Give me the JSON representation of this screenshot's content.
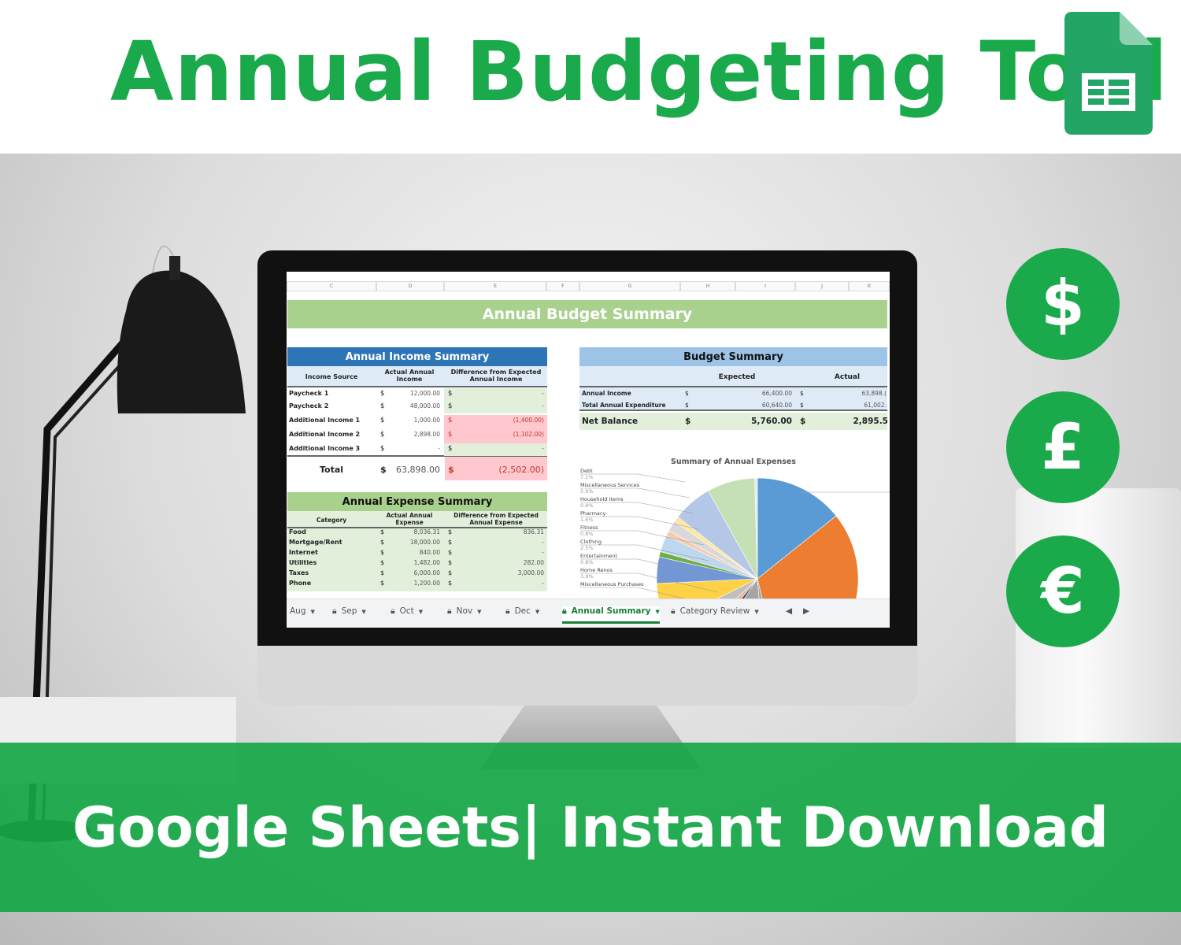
{
  "banner": {
    "title": "Annual Budgeting Tool",
    "footer": "Google Sheets| Instant Download",
    "accent": "#1aaa4b"
  },
  "icons": [
    "google-sheets-icon",
    "dollar-icon",
    "pound-icon",
    "euro-icon",
    "desk-lamp"
  ],
  "currency": [
    "$",
    "£",
    "€"
  ],
  "sheet": {
    "columns": [
      "C",
      "D",
      "E",
      "F",
      "G",
      "H",
      "I",
      "J",
      "K"
    ],
    "title": "Annual Budget Summary",
    "income": {
      "title": "Annual Income Summary",
      "headers": [
        "Income Source",
        "Actual Annual Income",
        "Difference from Expected Annual Income"
      ],
      "rows": [
        {
          "source": "Paycheck 1",
          "actual": "12,000.00",
          "diff": "-",
          "neg": false
        },
        {
          "source": "Paycheck 2",
          "actual": "48,000.00",
          "diff": "-",
          "neg": false
        },
        {
          "source": "Additional Income 1",
          "actual": "1,000.00",
          "diff": "(1,400.00)",
          "neg": true
        },
        {
          "source": "Additional Income 2",
          "actual": "2,898.00",
          "diff": "(1,102.00)",
          "neg": true
        },
        {
          "source": "Additional Income 3",
          "actual": "-",
          "diff": "-",
          "neg": false
        }
      ],
      "total_label": "Total",
      "total_actual": "63,898.00",
      "total_diff": "(2,502.00)",
      "currency": "$"
    },
    "expense": {
      "title": "Annual Expense Summary",
      "headers": [
        "Category",
        "Actual Annual Expense",
        "Difference from Expected Annual Expense"
      ],
      "rows": [
        {
          "category": "Food",
          "actual": "8,036.31",
          "diff": "836.31"
        },
        {
          "category": "Mortgage/Rent",
          "actual": "18,000.00",
          "diff": "-"
        },
        {
          "category": "Internet",
          "actual": "840.00",
          "diff": "-"
        },
        {
          "category": "Utilities",
          "actual": "1,482.00",
          "diff": "282.00"
        },
        {
          "category": "Taxes",
          "actual": "6,000.00",
          "diff": "3,000.00"
        },
        {
          "category": "Phone",
          "actual": "1,200.00",
          "diff": "-"
        }
      ]
    },
    "budget": {
      "title": "Budget Summary",
      "headers": [
        "Expected",
        "Actual"
      ],
      "rows": [
        {
          "label": "Annual Income",
          "expected": "66,400.00",
          "actual": "63,898.("
        },
        {
          "label": "Total Annual Expenditure",
          "expected": "60,640.00",
          "actual": "61,002."
        }
      ],
      "net": {
        "label": "Net Balance",
        "expected": "5,760.00",
        "actual": "2,895.5"
      }
    },
    "tabs": [
      {
        "label": "Aug",
        "locked": false,
        "active": false
      },
      {
        "label": "Sep",
        "locked": true,
        "active": false
      },
      {
        "label": "Oct",
        "locked": true,
        "active": false
      },
      {
        "label": "Nov",
        "locked": true,
        "active": false
      },
      {
        "label": "Dec",
        "locked": true,
        "active": false
      },
      {
        "label": "Annual Summary",
        "locked": true,
        "active": true
      },
      {
        "label": "Category Review",
        "locked": true,
        "active": false
      }
    ]
  },
  "chart_data": {
    "type": "pie",
    "title": "Summary of Annual Expenses",
    "slices": [
      {
        "label": "",
        "value": 13.2,
        "color": "#5b9bd5"
      },
      {
        "label": "",
        "value": 29.5,
        "color": "#ed7d31"
      },
      {
        "label": "",
        "value": 2.4,
        "color": "#a5a5a5"
      },
      {
        "label": "",
        "value": 9.8,
        "color": "#a5a5a5"
      },
      {
        "label": "",
        "value": 1.4,
        "color": "#264478"
      },
      {
        "label": "",
        "value": 2.0,
        "color": "#f4b183"
      },
      {
        "label": "",
        "value": 4.4,
        "color": "#bfbfbf"
      },
      {
        "label": "Miscellaneous Purchases",
        "value": 6.0,
        "color": "#ffd145"
      },
      {
        "label": "Home Renos",
        "value": 3.9,
        "color": "#7297d6"
      },
      {
        "label": "Entertainment",
        "value": 0.8,
        "color": "#70ad47"
      },
      {
        "label": "Clothing",
        "value": 2.5,
        "color": "#bdd7ee"
      },
      {
        "label": "Fitness",
        "value": 0.8,
        "color": "#f8cbad"
      },
      {
        "label": "Pharmacy",
        "value": 1.6,
        "color": "#d9d9d9"
      },
      {
        "label": "Household Items",
        "value": 0.8,
        "color": "#ffe699"
      },
      {
        "label": "Miscellaneous Services",
        "value": 5.9,
        "color": "#b4c7e7"
      },
      {
        "label": "Debt",
        "value": 7.1,
        "color": "#c5e0b4"
      },
      {
        "label": "",
        "value": 0.4,
        "color": "#deebf7"
      }
    ],
    "percent_labels": [
      "7.1%",
      "5.9%",
      "0.8%",
      "1.6%",
      "0.8%",
      "2.5%",
      "0.8%",
      "3.9%"
    ]
  }
}
